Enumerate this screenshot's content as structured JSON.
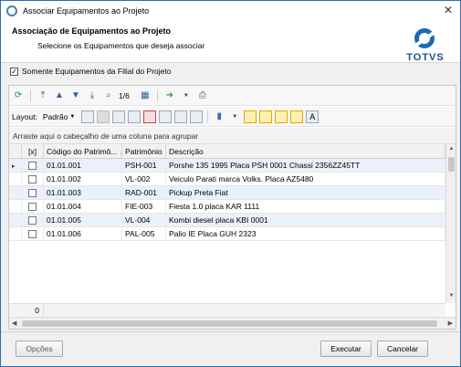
{
  "window": {
    "title": "Associar Equipamentos ao Projeto",
    "close_glyph": "✕"
  },
  "header": {
    "heading": "Associação de Equipamentos ao Projeto",
    "subheading": "Selecione os Equipamentos que deseja associar",
    "logo_text": "TOTVS"
  },
  "filter_checkbox": {
    "label": "Somente Equipamentos da Filial do Projeto",
    "checked": true,
    "mark": "✓"
  },
  "toolbar1": {
    "position_text": "1/6"
  },
  "toolbar2": {
    "layout_label": "Layout:",
    "layout_value": "Padrão"
  },
  "group_area": {
    "text": "Arraste aqui o cabeçalho de uma coluna para agrupar"
  },
  "grid": {
    "headers": [
      "[x]",
      "Código do Patrimô...",
      "Patrimônio",
      "Descrição"
    ],
    "sort_indicator": "▲",
    "rows": [
      {
        "code": "01.01.001",
        "patrimonio": "PSH-001",
        "descricao": "Porshe 135 1995 Placa  PSH 0001 Chassi 2356ZZ45TT",
        "current": true
      },
      {
        "code": "01.01.002",
        "patrimonio": "VL-002",
        "descricao": "Veiculo Parati marca Volks. Placa AZ5480",
        "current": false
      },
      {
        "code": "01.01.003",
        "patrimonio": "RAD-001",
        "descricao": "Pickup Preta Fiat",
        "current": false
      },
      {
        "code": "01.01.004",
        "patrimonio": "FIE-003",
        "descricao": "Fiesta 1.0  placa KAR 1111",
        "current": false
      },
      {
        "code": "01.01.005",
        "patrimonio": "VL-004",
        "descricao": "Kombi  diesel placa KBI 0001",
        "current": false
      },
      {
        "code": "01.01.006",
        "patrimonio": "PAL-005",
        "descricao": "Palio IE Placa GUH 2323",
        "current": false
      }
    ],
    "footer_count": "0",
    "row_indicator": "▸"
  },
  "buttons": {
    "opcoes": "Opções",
    "executar": "Executar",
    "cancelar": "Cancelar"
  },
  "colors": {
    "accent": "#1a6cb4",
    "row_alt": "#eaf1fb",
    "highlight": "#fff2b0"
  }
}
